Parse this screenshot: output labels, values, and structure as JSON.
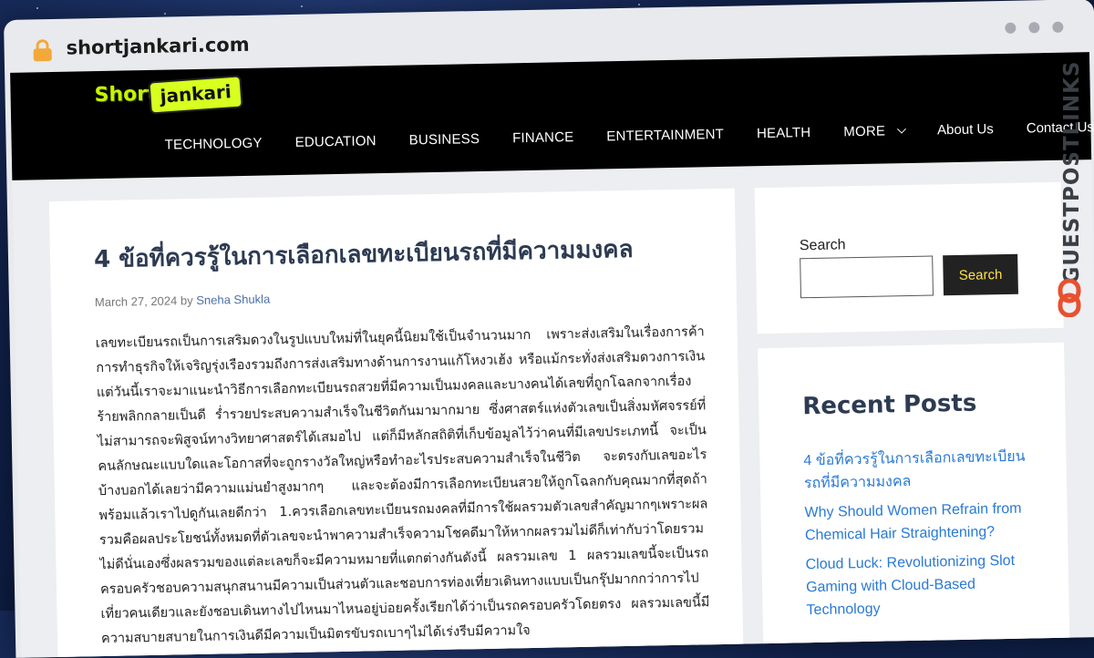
{
  "browser": {
    "url": "shortjankari.com"
  },
  "site": {
    "logo": {
      "part1": "Short",
      "part2": "jankari"
    },
    "nav": [
      "TECHNOLOGY",
      "EDUCATION",
      "BUSINESS",
      "FINANCE",
      "ENTERTAINMENT",
      "HEALTH",
      "MORE",
      "About Us",
      "Contact Us"
    ]
  },
  "article": {
    "title": "4 ข้อที่ควรรู้ในการเลือกเลขทะเบียนรถที่มีความมงคล",
    "date": "March 27, 2024",
    "by": "by",
    "author": "Sneha Shukla",
    "body": "เลขทะเบียนรถเป็นการเสริมดวงในรูปแบบใหม่ที่ในยุคนี้นิยมใช้เป็นจำนวนมาก เพราะส่งเสริมในเรื่องการค้าการทำธุรกิจให้เจริญรุ่งเรืองรวมถึงการส่งเสริมทางด้านการงานแก้โหงวเฮ้ง หรือแม้กระทั่งส่งเสริมดวงการเงินแต่วันนี้เราจะมาแนะนำวิธีการเลือกทะเบียนรถสวยที่มีความเป็นมงคลและบางคนได้เลขที่ถูกโฉลกจากเรื่องร้ายพลิกกลายเป็นดี ร่ำรวยประสบความสำเร็จในชีวิตกันมามากมาย ซึ่งศาสตร์แห่งตัวเลขเป็นสิ่งมหัศจรรย์ที่ไม่สามารถจะพิสูจน์ทางวิทยาศาสตร์ได้เสมอไป แต่ก็มีหลักสถิติที่เก็บข้อมูลไว้ว่าคนที่มีเลขประเภทนี้ จะเป็นคนลักษณะแบบใดและโอกาสที่จะถูกรางวัลใหญ่หรือทำอะไรประสบความสำเร็จในชีวิต จะตรงกับเลขอะไรบ้างบอกได้เลยว่ามีความแม่นยำสูงมากๆ และจะต้องมีการเลือกทะเบียนสวยให้ถูกโฉลกกับคุณมากที่สุดถ้าพร้อมแล้วเราไปดูกันเลยดีกว่า  1.ควรเลือกเลขทะเบียนรถมงคลที่มีการใช้ผลรวมตัวเลขสำคัญมากๆเพราะผลรวมคือผลประโยชน์ทั้งหมดที่ตัวเลขจะนำพาความสำเร็จความโชคดีมาให้หากผลรวมไม่ดีก็เท่ากับว่าโดยรวมไม่ดีนั่นเองซึ่งผลรวมของแต่ละเลขก็จะมีความหมายที่แตกต่างกันดังนี้  ผลรวมเลข 1 ผลรวมเลขนี้จะเป็นรถครอบครัวชอบความสนุกสนานมีความเป็นส่วนตัวและชอบการท่องเที่ยวเดินทางแบบเป็นกรุ๊ปมากกว่าการไปเที่ยวคนเดียวและยังชอบเดินทางไปไหนมาไหนอยู่บ่อยครั้งเรียกได้ว่าเป็นรถครอบครัวโดยตรง ผลรวมเลขนี้มีความสบายสบายในการเงินดีมีความเป็นมิตรขับรถเบาๆไม่ได้เร่งรีบมีความใจ"
  },
  "sidebar": {
    "search_label": "Search",
    "search_button": "Search",
    "recent_title": "Recent Posts",
    "recent_posts": [
      "4 ข้อที่ควรรู้ในการเลือกเลขทะเบียนรถที่มีความมงคล",
      "Why Should Women Refrain from Chemical Hair Straightening?",
      "Cloud Luck: Revolutionizing Slot Gaming with Cloud-Based Technology"
    ]
  },
  "watermark": {
    "text": "GUESTPOSTLINKS"
  },
  "colors": {
    "header_bg": "#000000",
    "link": "#2a7ad5",
    "heading": "#2d3b52",
    "logo_accent": "#d7ff1f",
    "lock": "#f3a93a",
    "search_btn_text": "#ffe24a"
  },
  "icons": [
    "lock-icon",
    "chevron-down-icon",
    "window-dot-icon",
    "link-ring-icon"
  ]
}
